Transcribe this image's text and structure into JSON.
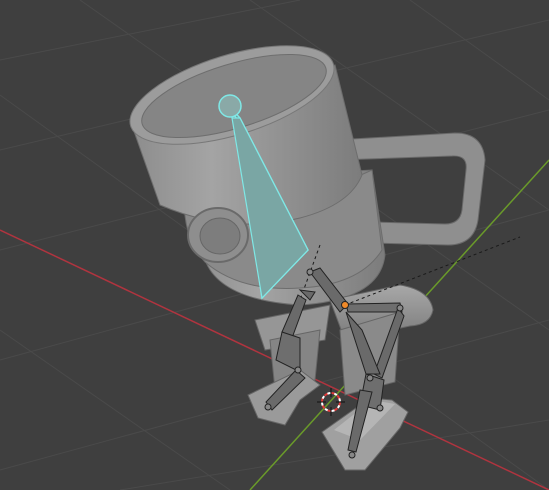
{
  "viewport": {
    "background": "#3f3f3f",
    "grid_color": "#4a4a4a",
    "x_axis_color": "#b0343f",
    "y_axis_color": "#6a9a2a"
  },
  "scene": {
    "mesh_color": "#9a9a9a",
    "mesh_shadow": "#6e6e6e",
    "selected_bone_outline": "#7fe8e6",
    "selected_bone_fill": "#6f9a98",
    "bone_fill": "#6a6a6a",
    "active_joint": "#f08a2a",
    "cursor_color": "#e33a3a"
  }
}
